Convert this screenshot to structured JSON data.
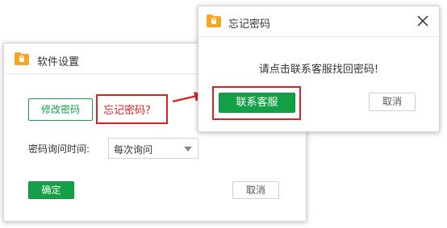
{
  "settings_dialog": {
    "title": "软件设置",
    "modify_password_label": "修改密码",
    "forgot_password_label": "忘记密码?",
    "password_interval_label": "密码询问时间:",
    "password_interval_value": "每次询问",
    "confirm_label": "确定",
    "cancel_label": "取消"
  },
  "forgot_dialog": {
    "title": "忘记密码",
    "message": "请点击联系客服找回密码!",
    "contact_label": "联系客服",
    "cancel_label": "取消"
  },
  "colors": {
    "accent_green": "#13a046",
    "highlight_red": "#e02020",
    "icon_orange": "#f5a623"
  },
  "icons": {
    "app_icon": "lock-folder-icon",
    "close_icon": "close-icon",
    "dropdown_icon": "chevron-down-icon",
    "arrow_icon": "right-arrow-icon"
  }
}
